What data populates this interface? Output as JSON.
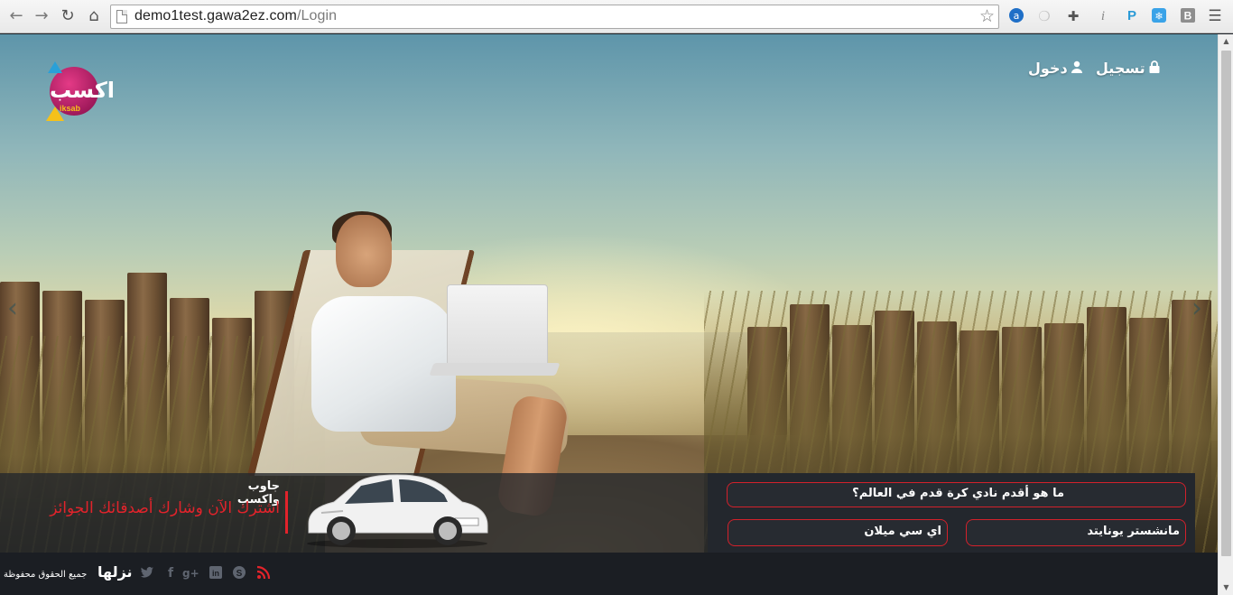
{
  "browser": {
    "url_host": "demo1test.gawa2ez.com",
    "url_path": "/Login",
    "nav_icons": [
      "back-icon",
      "forward-icon",
      "reload-icon",
      "home-icon"
    ],
    "extension_icons": [
      "adblock-icon",
      "ghost-icon",
      "crosshair-icon",
      "info-icon",
      "pinterest-icon",
      "snowflake-icon",
      "bookmark-b-icon",
      "menu-icon"
    ]
  },
  "header": {
    "logo_text": "اكسب",
    "logo_sub": "iksab",
    "register_label": "تسجيل",
    "login_label": "دخول"
  },
  "promo": {
    "title": "جاوب واكسب",
    "text": "اشترك الآن وشارك أصدقائك الجوائز"
  },
  "quiz": {
    "question": "ما هو أقدم نادي كرة قدم في العالم؟",
    "answers": [
      "مانشستر يونايتد",
      "اي سي ميلان"
    ]
  },
  "footer": {
    "brand": "نزلها",
    "copyright": "جميع الحقوق محفوظة",
    "social_icons": [
      "twitter-icon",
      "facebook-icon",
      "google-plus-icon",
      "linkedin-icon",
      "skype-icon",
      "rss-icon"
    ]
  },
  "colors": {
    "accent_red": "#d3212b",
    "bar_dark": "#23272d",
    "rss_red": "#e2232b"
  }
}
